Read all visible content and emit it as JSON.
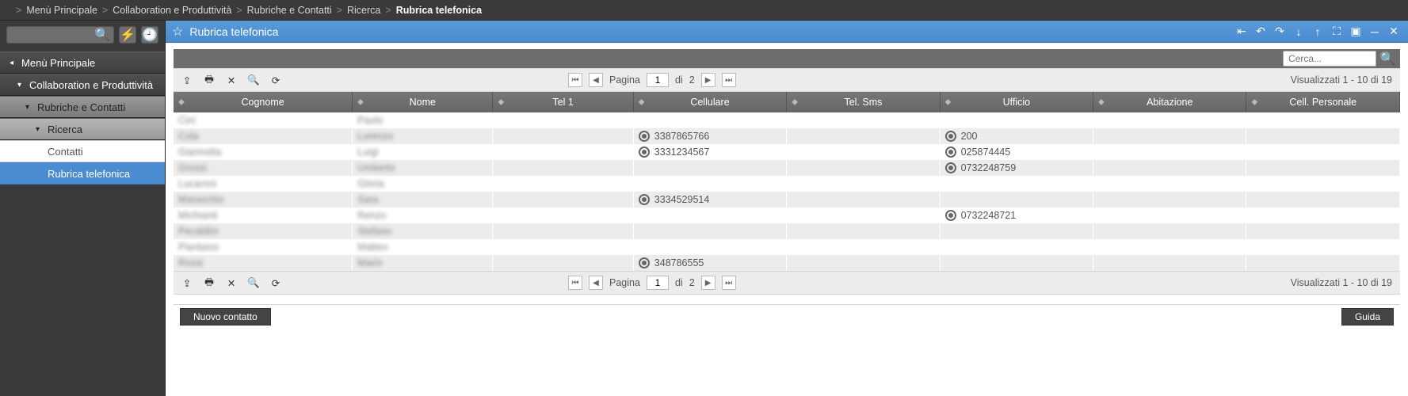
{
  "breadcrumb": {
    "items": [
      "Menù Principale",
      "Collaboration e Produttività",
      "Rubriche e Contatti",
      "Ricerca"
    ],
    "current": "Rubrica telefonica"
  },
  "sidebar": {
    "search_placeholder": "",
    "items": [
      {
        "label": "Menù Principale",
        "level": 1,
        "arrow": "◂"
      },
      {
        "label": "Collaboration e Produttività",
        "level": 2,
        "arrow": "▾"
      },
      {
        "label": "Rubriche e Contatti",
        "level": 3,
        "arrow": "▾"
      },
      {
        "label": "Ricerca",
        "level": 4,
        "arrow": "▾"
      },
      {
        "label": "Contatti",
        "level": 5,
        "kind": "white"
      },
      {
        "label": "Rubrica telefonica",
        "level": 5,
        "kind": "active"
      }
    ]
  },
  "titlebar": {
    "title": "Rubrica telefonica"
  },
  "searchstripe": {
    "placeholder": "Cerca..."
  },
  "pager": {
    "label_page": "Pagina",
    "current": "1",
    "of_label": "di",
    "total_pages": "2",
    "summary": "Visualizzati 1 - 10 di 19"
  },
  "columns": [
    "Cognome",
    "Nome",
    "Tel 1",
    "Cellulare",
    "Tel. Sms",
    "Ufficio",
    "Abitazione",
    "Cell. Personale"
  ],
  "rows": [
    {
      "cognome": "Cini",
      "nome": "Paolo",
      "tel1": "",
      "cellulare": "",
      "telSms": "",
      "ufficio": "",
      "abitazione": "",
      "cellPersonale": ""
    },
    {
      "cognome": "Cola",
      "nome": "Lorenzo",
      "tel1": "",
      "cellulare": "3387865766",
      "telSms": "",
      "ufficio": "200",
      "abitazione": "",
      "cellPersonale": ""
    },
    {
      "cognome": "Giannotta",
      "nome": "Luigi",
      "tel1": "",
      "cellulare": "3331234567",
      "telSms": "",
      "ufficio": "025874445",
      "abitazione": "",
      "cellPersonale": ""
    },
    {
      "cognome": "Grossi",
      "nome": "Umberto",
      "tel1": "",
      "cellulare": "",
      "telSms": "",
      "ufficio": "0732248759",
      "abitazione": "",
      "cellPersonale": ""
    },
    {
      "cognome": "Lucaroni",
      "nome": "Gloria",
      "tel1": "",
      "cellulare": "",
      "telSms": "",
      "ufficio": "",
      "abitazione": "",
      "cellPersonale": ""
    },
    {
      "cognome": "Maraschio",
      "nome": "Sara",
      "tel1": "",
      "cellulare": "3334529514",
      "telSms": "",
      "ufficio": "",
      "abitazione": "",
      "cellPersonale": ""
    },
    {
      "cognome": "Michianti",
      "nome": "Renzo",
      "tel1": "",
      "cellulare": "",
      "telSms": "",
      "ufficio": "0732248721",
      "abitazione": "",
      "cellPersonale": ""
    },
    {
      "cognome": "Pecaldini",
      "nome": "Stefano",
      "tel1": "",
      "cellulare": "",
      "telSms": "",
      "ufficio": "",
      "abitazione": "",
      "cellPersonale": ""
    },
    {
      "cognome": "Piantassi",
      "nome": "Matteo",
      "tel1": "",
      "cellulare": "",
      "telSms": "",
      "ufficio": "",
      "abitazione": "",
      "cellPersonale": ""
    },
    {
      "cognome": "Rossi",
      "nome": "Mario",
      "tel1": "",
      "cellulare": "348786555",
      "telSms": "",
      "ufficio": "",
      "abitazione": "",
      "cellPersonale": ""
    }
  ],
  "footer": {
    "new_contact": "Nuovo contatto",
    "help": "Guida"
  }
}
